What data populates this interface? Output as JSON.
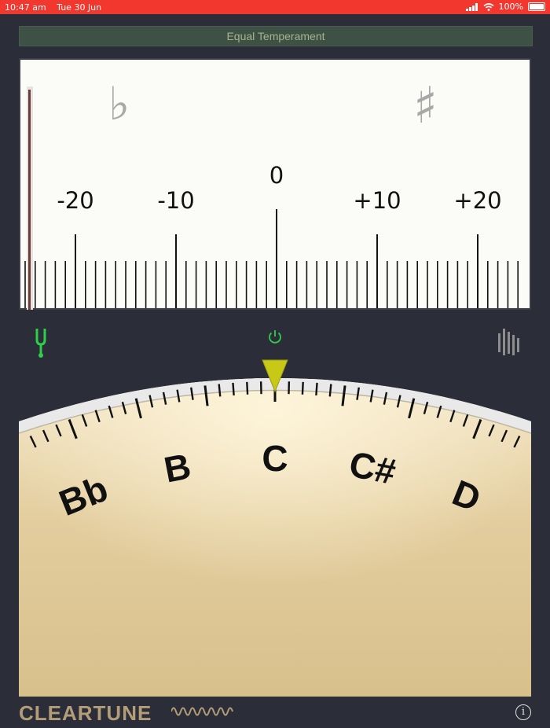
{
  "status": {
    "time": "10:47 am",
    "date": "Tue 30 Jun",
    "battery": "100%",
    "icons": [
      "signal-icon",
      "wifi-icon",
      "battery-icon"
    ]
  },
  "tuner": {
    "temperament": "Equal Temperament",
    "flat_symbol": "♭",
    "sharp_symbol": "♯",
    "cents_labels": [
      "-20",
      "-10",
      "0",
      "+10",
      "+20"
    ],
    "cents_value": 0
  },
  "dial": {
    "notes": [
      "Bb",
      "B",
      "C",
      "C#",
      "D"
    ],
    "current_note": "C"
  },
  "footer": {
    "logo": "CLEARTUNE"
  },
  "colors": {
    "status_bar": "#f2372f",
    "accent_green": "#2fcf4a",
    "dial_face": "#e8d5a8",
    "pointer": "#c8c816"
  }
}
